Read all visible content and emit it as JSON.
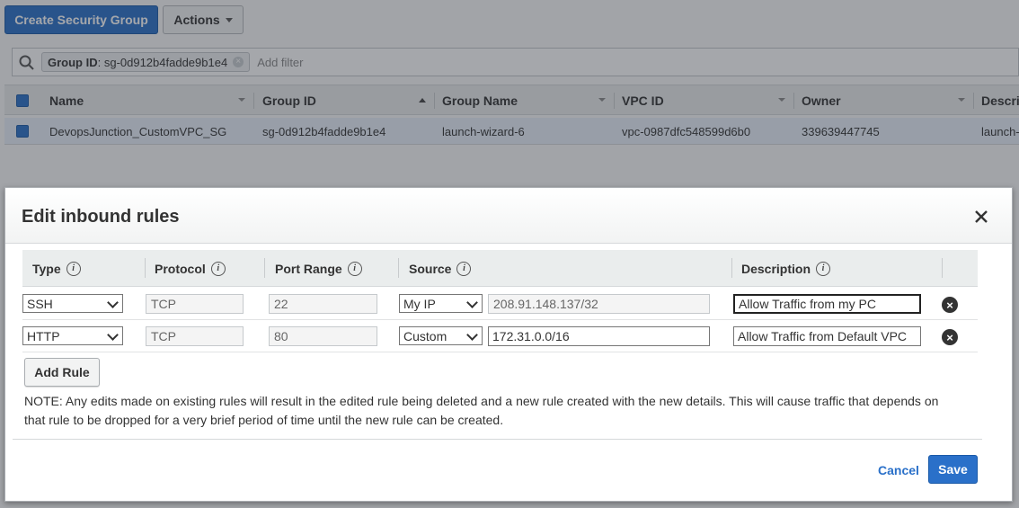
{
  "toolbar": {
    "create_label": "Create Security Group",
    "actions_label": "Actions"
  },
  "filter": {
    "token_key": "Group ID",
    "token_value": ": sg-0d912b4fadde9b1e4",
    "add_placeholder": "Add filter"
  },
  "table": {
    "columns": [
      "Name",
      "Group ID",
      "Group Name",
      "VPC ID",
      "Owner",
      "Descri"
    ],
    "row": {
      "name": "DevopsJunction_CustomVPC_SG",
      "group_id": "sg-0d912b4fadde9b1e4",
      "group_name": "launch-wizard-6",
      "vpc_id": "vpc-0987dfc548599d6b0",
      "owner": "339639447745",
      "description": "launch-"
    }
  },
  "modal": {
    "title": "Edit inbound rules",
    "headers": {
      "type": "Type",
      "protocol": "Protocol",
      "port_range": "Port Range",
      "source": "Source",
      "description": "Description"
    },
    "rules": [
      {
        "type": "SSH",
        "protocol": "TCP",
        "port_range": "22",
        "source_type": "My IP",
        "source_value": "208.91.148.137/32",
        "description": "Allow Traffic from my PC"
      },
      {
        "type": "HTTP",
        "protocol": "TCP",
        "port_range": "80",
        "source_type": "Custom",
        "source_value": "172.31.0.0/16",
        "description": "Allow Traffic from Default VPC"
      }
    ],
    "add_rule_label": "Add Rule",
    "note": "NOTE: Any edits made on existing rules will result in the edited rule being deleted and a new rule created with the new details. This will cause traffic that depends on that rule to be dropped for a very brief period of time until the new rule can be created.",
    "cancel_label": "Cancel",
    "save_label": "Save"
  },
  "colors": {
    "primary": "#2a70c9",
    "header_bg": "#eaeded",
    "overlay": "rgba(40,45,55,0.42)"
  }
}
